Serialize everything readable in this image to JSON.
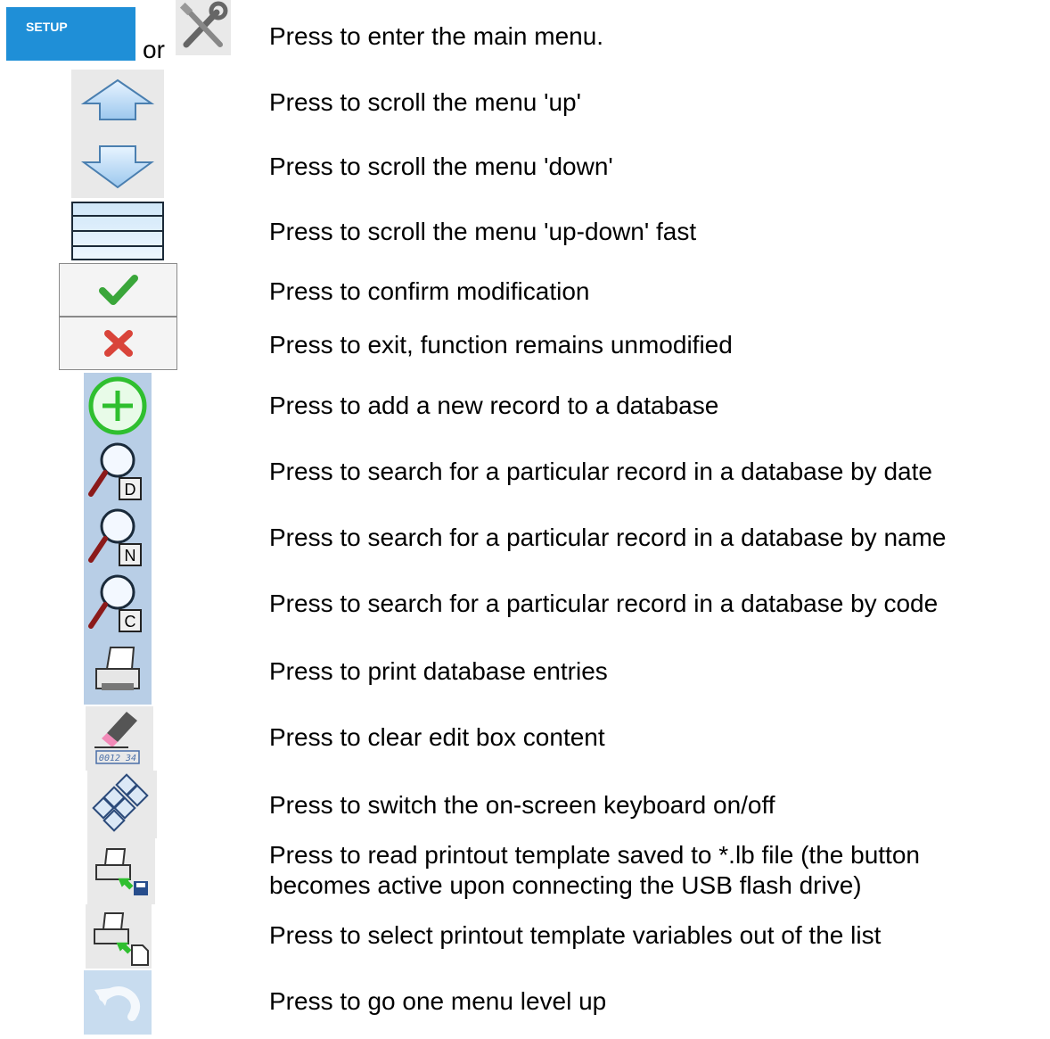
{
  "items": [
    {
      "icon": "setup-button",
      "desc": "Press to enter the main menu."
    },
    {
      "icon": "arrow-up-icon",
      "desc": "Press to scroll the menu 'up'"
    },
    {
      "icon": "arrow-down-icon",
      "desc": "Press to scroll the menu 'down'"
    },
    {
      "icon": "scroll-fast-icon",
      "desc": "Press to scroll the menu 'up-down' fast"
    },
    {
      "icon": "checkmark-icon",
      "desc": "Press to confirm modification"
    },
    {
      "icon": "cross-icon",
      "desc": "Press to exit, function remains unmodified"
    },
    {
      "icon": "add-record-icon",
      "desc": "Press to add a new record to a database"
    },
    {
      "icon": "search-date-icon",
      "desc": "Press to search for a particular record in a database by date"
    },
    {
      "icon": "search-name-icon",
      "desc": "Press to search for a particular record in a database by name"
    },
    {
      "icon": "search-code-icon",
      "desc": "Press to search for a particular record in a database by code"
    },
    {
      "icon": "printer-icon",
      "desc": "Press to print database entries"
    },
    {
      "icon": "eraser-icon",
      "desc": "Press to clear edit box content"
    },
    {
      "icon": "keyboard-icon",
      "desc": "Press to switch the on-screen keyboard on/off"
    },
    {
      "icon": "read-template-icon",
      "desc": "Press to read printout template saved to *.lb file (the button becomes active upon connecting the USB flash drive)"
    },
    {
      "icon": "select-variables-icon",
      "desc": "Press to select printout template variables out of the list"
    },
    {
      "icon": "undo-icon",
      "desc": "Press to go one menu level up"
    }
  ],
  "setup_label": "SETUP",
  "or_label": "or",
  "read_template_line1": "Press to read printout template saved to *.lb file (the button",
  "read_template_line2": "becomes active upon connecting the USB flash drive)",
  "search_letters": [
    "D",
    "N",
    "C"
  ],
  "eraser_display": "0012 34"
}
